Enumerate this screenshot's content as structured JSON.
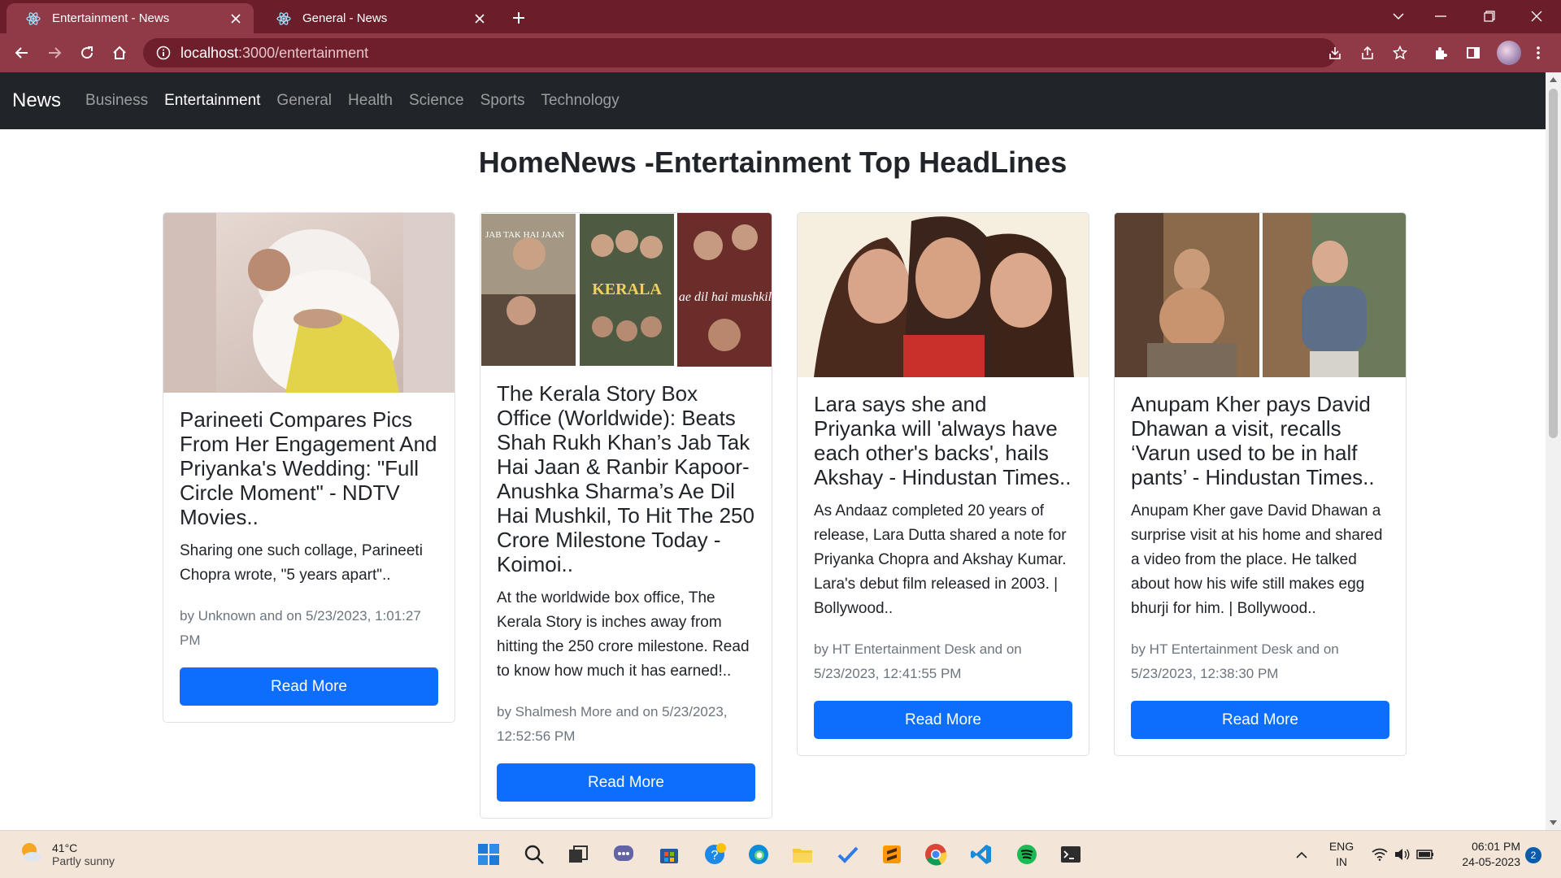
{
  "browser": {
    "tabs": [
      {
        "title": "Entertainment - News",
        "active": true
      },
      {
        "title": "General - News",
        "active": false
      }
    ],
    "url_host": "localhost",
    "url_path": ":3000/entertainment"
  },
  "navbar": {
    "brand": "News",
    "links": [
      "Business",
      "Entertainment",
      "General",
      "Health",
      "Science",
      "Sports",
      "Technology"
    ],
    "active": "Entertainment"
  },
  "heading": "HomeNews -Entertainment Top HeadLines",
  "cards": [
    {
      "title": "Parineeti Compares Pics From Her Engagement And Priyanka's Wedding: \"Full Circle Moment\" - NDTV Movies..",
      "description": "Sharing one such collage, Parineeti Chopra wrote, \"5 years apart\"..",
      "meta": "by Unknown and on 5/23/2023, 1:01:27 PM",
      "button": "Read More"
    },
    {
      "title": "The Kerala Story Box Office (Worldwide): Beats Shah Rukh Khan’s Jab Tak Hai Jaan & Ranbir Kapoor-Anushka Sharma’s Ae Dil Hai Mushkil, To Hit The 250 Crore Milestone Today - Koimoi..",
      "description": "At the worldwide box office, The Kerala Story is inches away from hitting the 250 crore milestone. Read to know how much it has earned!..",
      "meta": "by Shalmesh More and on 5/23/2023, 12:52:56 PM",
      "button": "Read More",
      "poster_texts": [
        "JAB TAK HAI JAAN",
        "KERALA",
        "ae dil hai mushkil"
      ]
    },
    {
      "title": "Lara says she and Priyanka will 'always have each other's backs', hails Akshay - Hindustan Times..",
      "description": "As Andaaz completed 20 years of release, Lara Dutta shared a note for Priyanka Chopra and Akshay Kumar. Lara's debut film released in 2003. | Bollywood..",
      "meta": "by HT Entertainment Desk and on 5/23/2023, 12:41:55 PM",
      "button": "Read More"
    },
    {
      "title": "Anupam Kher pays David Dhawan a visit, recalls ‘Varun used to be in half pants’ - Hindustan Times..",
      "description": "Anupam Kher gave David Dhawan a surprise visit at his home and shared a video from the place. He talked about how his wife still makes egg bhurji for him. | Bollywood..",
      "meta": "by HT Entertainment Desk and on 5/23/2023, 12:38:30 PM",
      "button": "Read More"
    }
  ],
  "taskbar": {
    "weather_temp": "41°C",
    "weather_desc": "Partly sunny",
    "lang_line1": "ENG",
    "lang_line2": "IN",
    "time": "06:01 PM",
    "date": "24-05-2023",
    "notifications": "2",
    "apps": [
      "start-icon",
      "search-icon",
      "task-view-icon",
      "teams-chat-icon",
      "store-icon",
      "tips-icon",
      "edge-icon",
      "file-explorer-icon",
      "todo-icon",
      "sublime-icon",
      "chrome-icon",
      "vscode-icon",
      "spotify-icon",
      "terminal-icon"
    ]
  },
  "colors": {
    "tabbar": "#6b1e2a",
    "toolbar": "#8f3a46",
    "navbar": "#212529",
    "primary_button": "#0d6efd"
  }
}
